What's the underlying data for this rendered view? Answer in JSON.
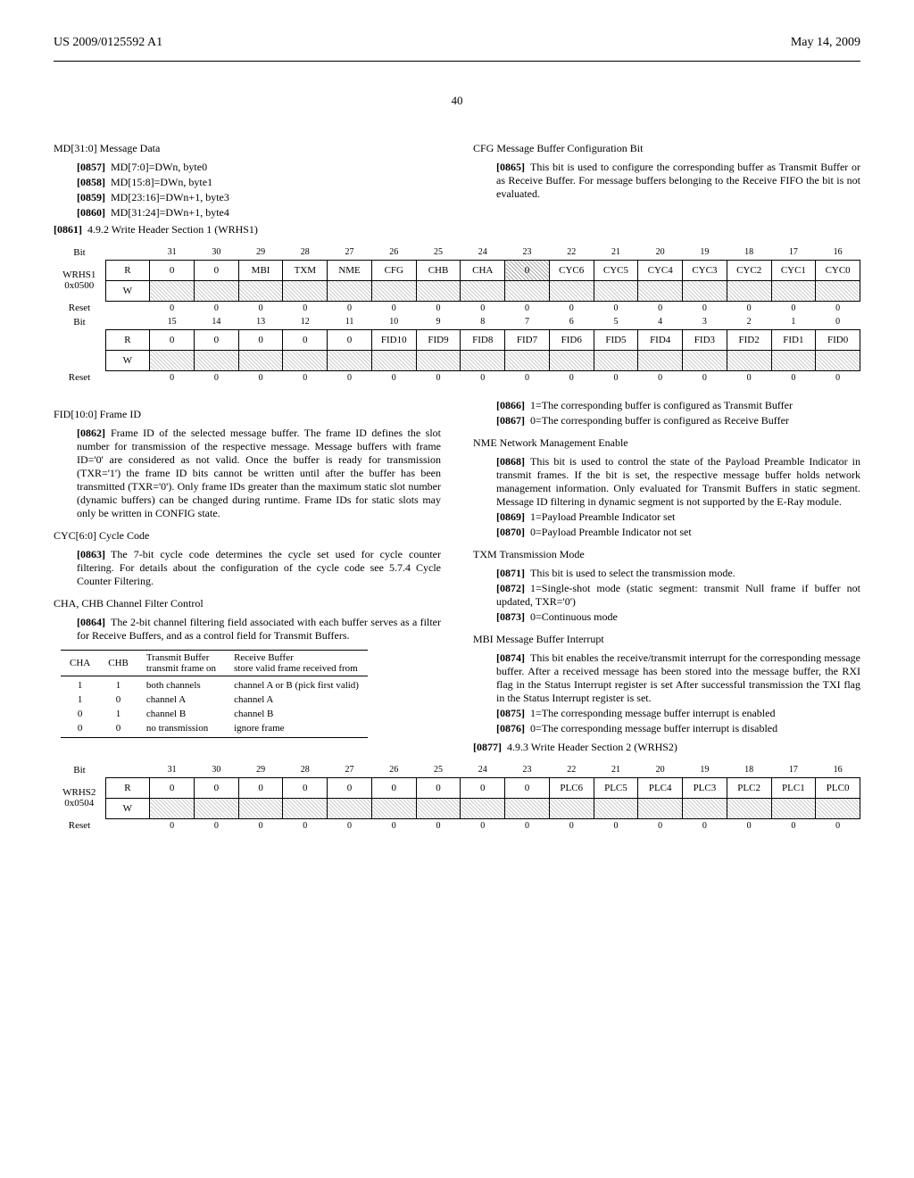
{
  "header": {
    "left": "US 2009/0125592 A1",
    "right": "May 14, 2009"
  },
  "page": "40",
  "md": {
    "title": "MD[31:0] Message Data",
    "items": [
      {
        "num": "[0857]",
        "text": "MD[7:0]=DWn, byte0"
      },
      {
        "num": "[0858]",
        "text": "MD[15:8]=DWn, byte1"
      },
      {
        "num": "[0859]",
        "text": "MD[23:16]=DWn+1, byte3"
      },
      {
        "num": "[0860]",
        "text": "MD[31:24]=DWn+1, byte4"
      }
    ],
    "sub": {
      "num": "[0861]",
      "text": "4.9.2 Write Header Section 1 (WRHS1)"
    }
  },
  "cfg": {
    "title": "CFG Message Buffer Configuration Bit",
    "p": {
      "num": "[0865]",
      "text": "This bit is used to configure the corresponding buffer as Transmit Buffer or as Receive Buffer. For message buffers belonging to the Receive FIFO the bit is not evaluated."
    }
  },
  "wrhs1": {
    "name": "WRHS1",
    "addr": "0x0500",
    "bit_hi": [
      "31",
      "30",
      "29",
      "28",
      "27",
      "26",
      "25",
      "24",
      "23",
      "22",
      "21",
      "20",
      "19",
      "18",
      "17",
      "16"
    ],
    "bit_lo": [
      "15",
      "14",
      "13",
      "12",
      "11",
      "10",
      "9",
      "8",
      "7",
      "6",
      "5",
      "4",
      "3",
      "2",
      "1",
      "0"
    ],
    "row_hi": [
      {
        "t": "0"
      },
      {
        "t": "0"
      },
      {
        "t": "MBI"
      },
      {
        "t": "TXM"
      },
      {
        "t": "NME"
      },
      {
        "t": "CFG"
      },
      {
        "t": "CHB"
      },
      {
        "t": "CHA"
      },
      {
        "t": "0",
        "h": true
      },
      {
        "t": "CYC6"
      },
      {
        "t": "CYC5"
      },
      {
        "t": "CYC4"
      },
      {
        "t": "CYC3"
      },
      {
        "t": "CYC2"
      },
      {
        "t": "CYC1"
      },
      {
        "t": "CYC0"
      }
    ],
    "row_lo": [
      {
        "t": "0"
      },
      {
        "t": "0"
      },
      {
        "t": "0"
      },
      {
        "t": "0"
      },
      {
        "t": "0"
      },
      {
        "t": "FID10"
      },
      {
        "t": "FID9"
      },
      {
        "t": "FID8"
      },
      {
        "t": "FID7"
      },
      {
        "t": "FID6"
      },
      {
        "t": "FID5"
      },
      {
        "t": "FID4"
      },
      {
        "t": "FID3"
      },
      {
        "t": "FID2"
      },
      {
        "t": "FID1"
      },
      {
        "t": "FID0"
      }
    ],
    "reset": [
      "0",
      "0",
      "0",
      "0",
      "0",
      "0",
      "0",
      "0",
      "0",
      "0",
      "0",
      "0",
      "0",
      "0",
      "0",
      "0"
    ]
  },
  "fid": {
    "title": "FID[10:0] Frame ID",
    "p": {
      "num": "[0862]",
      "text": "Frame ID of the selected message buffer. The frame ID defines the slot number for transmission of the respective message. Message buffers with frame ID='0' are considered as not valid. Once the buffer is ready for transmission (TXR='1') the frame ID bits cannot be written until after the buffer has been transmitted (TXR='0'). Only frame IDs greater than the maximum static slot number (dynamic buffers) can be changed during runtime. Frame IDs for static slots may only be written in CONFIG state."
    }
  },
  "cyc": {
    "title": "CYC[6:0] Cycle Code",
    "p": {
      "num": "[0863]",
      "text": "The 7-bit cycle code determines the cycle set used for cycle counter filtering. For details about the configuration of the cycle code see 5.7.4 Cycle Counter Filtering."
    }
  },
  "ch": {
    "title": "CHA, CHB Channel Filter Control",
    "p": {
      "num": "[0864]",
      "text": "The 2-bit channel filtering field associated with each buffer serves as a filter for Receive Buffers, and as a control field for Transmit Buffers."
    },
    "headers": [
      "CHA",
      "CHB",
      "Transmit Buffer transmit frame on",
      "Receive Buffer store valid frame received from"
    ],
    "rows": [
      [
        "1",
        "1",
        "both channels",
        "channel A or B (pick first valid)"
      ],
      [
        "1",
        "0",
        "channel A",
        "channel A"
      ],
      [
        "0",
        "1",
        "channel B",
        "channel B"
      ],
      [
        "0",
        "0",
        "no transmission",
        "ignore frame"
      ]
    ]
  },
  "right": {
    "p0866": {
      "num": "[0866]",
      "text": "1=The corresponding buffer is configured as Transmit Buffer"
    },
    "p0867": {
      "num": "[0867]",
      "text": "0=The corresponding buffer is configured as Receive Buffer"
    },
    "nme": {
      "title": "NME Network Management Enable",
      "p": {
        "num": "[0868]",
        "text": "This bit is used to control the state of the Payload Preamble Indicator in transmit frames. If the bit is set, the respective message buffer holds network management information. Only evaluated for Transmit Buffers in static segment. Message ID filtering in dynamic segment is not supported by the E-Ray module."
      },
      "p1": {
        "num": "[0869]",
        "text": "1=Payload Preamble Indicator set"
      },
      "p0": {
        "num": "[0870]",
        "text": "0=Payload Preamble Indicator not set"
      }
    },
    "txm": {
      "title": "TXM Transmission Mode",
      "p": {
        "num": "[0871]",
        "text": "This bit is used to select the transmission mode."
      },
      "p1": {
        "num": "[0872]",
        "text": "1=Single-shot mode (static segment: transmit Null frame if buffer not updated, TXR='0')"
      },
      "p0": {
        "num": "[0873]",
        "text": "0=Continuous mode"
      }
    },
    "mbi": {
      "title": "MBI Message Buffer Interrupt",
      "p": {
        "num": "[0874]",
        "text": "This bit enables the receive/transmit interrupt for the corresponding message buffer. After a received message has been stored into the message buffer, the RXI flag in the Status Interrupt register is set After successful transmission the TXI flag in the Status Interrupt register is set."
      },
      "p1": {
        "num": "[0875]",
        "text": "1=The corresponding message buffer interrupt is enabled"
      },
      "p0": {
        "num": "[0876]",
        "text": "0=The corresponding message buffer interrupt is disabled"
      }
    },
    "wrhs2_title": {
      "num": "[0877]",
      "text": "4.9.3 Write Header Section 2 (WRHS2)"
    }
  },
  "wrhs2": {
    "name": "WRHS2",
    "addr": "0x0504",
    "bit_hi": [
      "31",
      "30",
      "29",
      "28",
      "27",
      "26",
      "25",
      "24",
      "23",
      "22",
      "21",
      "20",
      "19",
      "18",
      "17",
      "16"
    ],
    "row_hi": [
      {
        "t": "0"
      },
      {
        "t": "0"
      },
      {
        "t": "0"
      },
      {
        "t": "0"
      },
      {
        "t": "0"
      },
      {
        "t": "0"
      },
      {
        "t": "0"
      },
      {
        "t": "0"
      },
      {
        "t": "0"
      },
      {
        "t": "PLC6"
      },
      {
        "t": "PLC5"
      },
      {
        "t": "PLC4"
      },
      {
        "t": "PLC3"
      },
      {
        "t": "PLC2"
      },
      {
        "t": "PLC1"
      },
      {
        "t": "PLC0"
      }
    ],
    "reset": [
      "0",
      "0",
      "0",
      "0",
      "0",
      "0",
      "0",
      "0",
      "0",
      "0",
      "0",
      "0",
      "0",
      "0",
      "0",
      "0"
    ]
  },
  "labels": {
    "bit": "Bit",
    "reset": "Reset",
    "R": "R",
    "W": "W"
  }
}
